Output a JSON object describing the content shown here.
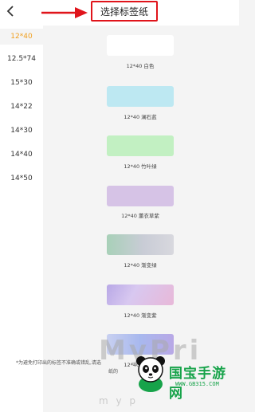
{
  "header": {
    "back_icon": "chevron-left-icon",
    "title": "选择标签纸",
    "annotation_arrow_color": "#e0141b"
  },
  "sidebar": {
    "items": [
      {
        "label": "12*40",
        "active": true
      },
      {
        "label": "12.5*74",
        "active": false
      },
      {
        "label": "15*30",
        "active": false
      },
      {
        "label": "14*22",
        "active": false
      },
      {
        "label": "14*30",
        "active": false
      },
      {
        "label": "14*40",
        "active": false
      },
      {
        "label": "14*50",
        "active": false
      }
    ],
    "active_color": "#f0a020"
  },
  "labels": [
    {
      "name": "12*40 白色",
      "color": "#ffffff"
    },
    {
      "name": "12*40 澜石蓝",
      "color": "#bde8f2"
    },
    {
      "name": "12*40 竹叶绿",
      "color": "#c2f0c2"
    },
    {
      "name": "12*40 薰衣草紫",
      "color": "#d6c3e6"
    },
    {
      "name": "12*40 渐变绿",
      "color": "#a8d0b8"
    },
    {
      "name": "12*40 渐变紫",
      "color": "#c4a8e0"
    },
    {
      "name": "12*40 渐变蓝",
      "color": "#a8b8ee"
    }
  ],
  "notice": {
    "text": "*为避免打印出的标签不准确或错乱,请选",
    "text2": "纸的"
  },
  "watermark": {
    "text": "MyPri",
    "sub": "m y p"
  },
  "logo": {
    "title": "国宝手游网",
    "url": "WWW.GB315.COM"
  }
}
